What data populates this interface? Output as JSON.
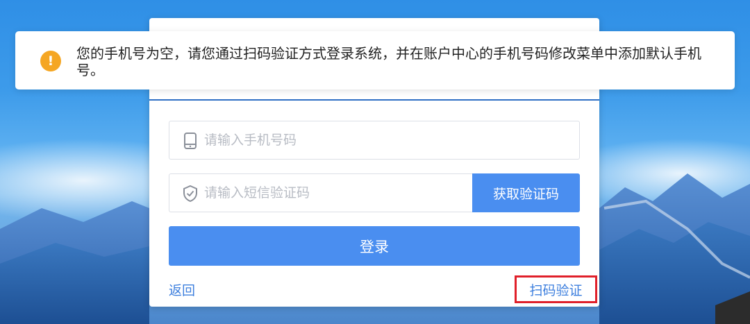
{
  "notification": {
    "icon": "warning-icon",
    "message": "您的手机号为空，请您通过扫码验证方式登录系统，并在账户中心的手机号码修改菜单中添加默认手机号。"
  },
  "form": {
    "phone_placeholder": "请输入手机号码",
    "phone_icon": "mobile-phone-icon",
    "sms_placeholder": "请输入短信验证码",
    "sms_icon": "shield-check-icon",
    "get_code_label": "获取验证码",
    "login_label": "登录",
    "back_label": "返回",
    "qr_verify_label": "扫码验证"
  },
  "colors": {
    "primary": "#4a8ef0",
    "link": "#3d7fde",
    "warning": "#f5a623",
    "highlight_border": "#e0202a"
  }
}
